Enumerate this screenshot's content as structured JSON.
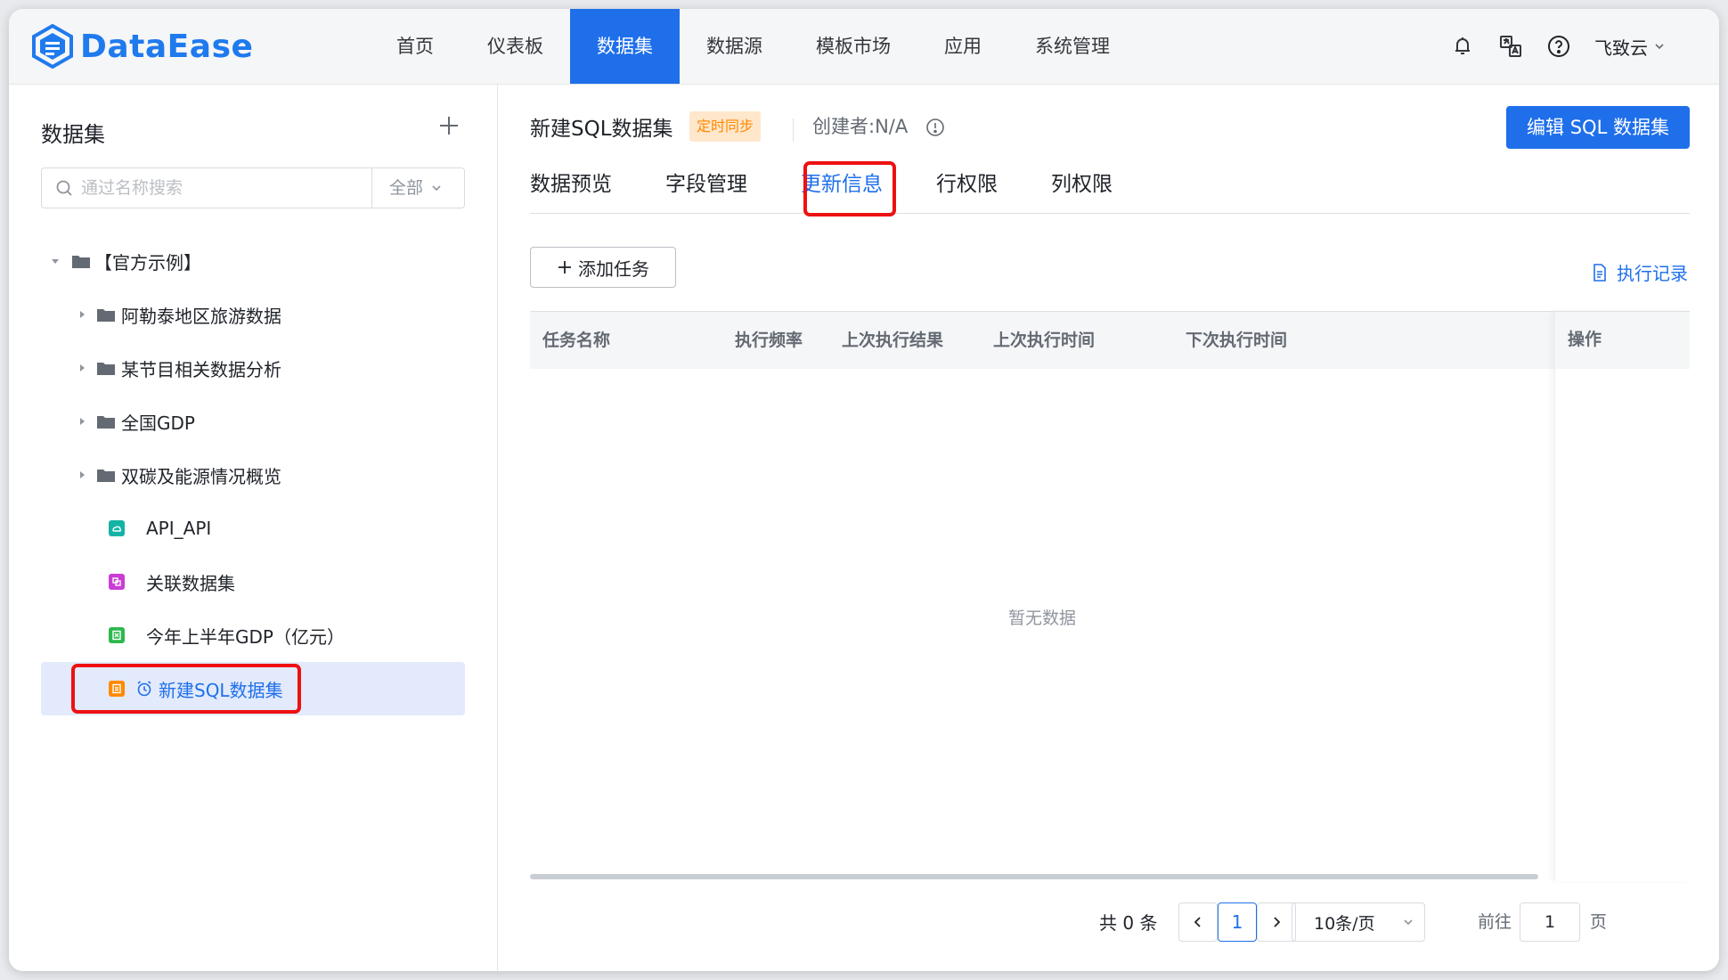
{
  "app": {
    "name": "DataEase"
  },
  "nav": {
    "items": [
      "首页",
      "仪表板",
      "数据集",
      "数据源",
      "模板市场",
      "应用",
      "系统管理"
    ],
    "active_index": 2
  },
  "user": {
    "name": "飞致云"
  },
  "sidebar": {
    "title": "数据集",
    "search": {
      "placeholder": "通过名称搜索",
      "filter": "全部"
    },
    "tree": [
      {
        "label": "【官方示例】",
        "type": "folder",
        "level": 0,
        "expanded": true
      },
      {
        "label": "阿勒泰地区旅游数据",
        "type": "folder",
        "level": 1
      },
      {
        "label": "某节目相关数据分析",
        "type": "folder",
        "level": 1
      },
      {
        "label": "全国GDP",
        "type": "folder",
        "level": 1
      },
      {
        "label": "双碳及能源情况概览",
        "type": "folder",
        "level": 1
      },
      {
        "label": "API_API",
        "type": "api",
        "level": 2
      },
      {
        "label": "关联数据集",
        "type": "union",
        "level": 2
      },
      {
        "label": "今年上半年GDP（亿元）",
        "type": "excel",
        "level": 2
      },
      {
        "label": "新建SQL数据集",
        "type": "sql",
        "level": 2,
        "selected": true
      }
    ]
  },
  "main": {
    "title": "新建SQL数据集",
    "tag": "定时同步",
    "creator": "创建者:N/A",
    "edit_button": "编辑 SQL 数据集",
    "tabs": [
      "数据预览",
      "字段管理",
      "更新信息",
      "行权限",
      "列权限"
    ],
    "active_tab": 2,
    "add_task": "添加任务",
    "exec_log": "执行记录",
    "table": {
      "columns": [
        "任务名称",
        "执行频率",
        "上次执行结果",
        "上次执行时间",
        "下次执行时间",
        "操作"
      ],
      "rows": [],
      "empty_text": "暂无数据"
    },
    "pagination": {
      "total_text": "共 0 条",
      "current_page": "1",
      "page_size": "10条/页",
      "goto_label": "前往",
      "goto_value": "1",
      "page_unit": "页"
    }
  },
  "colors": {
    "primary": "#1f6fea",
    "highlight": "#ee1111",
    "tag_text": "#ff8800",
    "tag_bg": "#ffe7cc"
  }
}
